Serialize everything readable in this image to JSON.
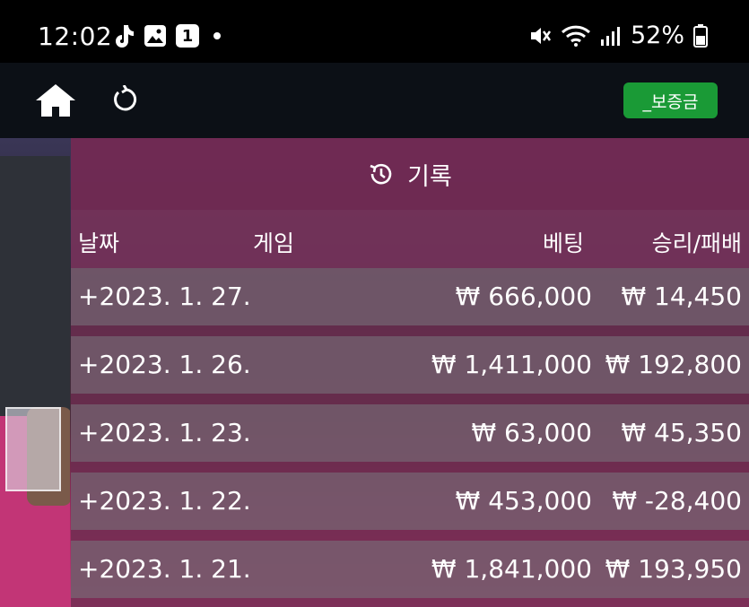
{
  "status_bar": {
    "time": "12:02",
    "notification_badge": "1",
    "battery": "52%"
  },
  "app_bar": {
    "deposit_label": "_보증금"
  },
  "panel": {
    "title": "기록",
    "columns": {
      "date": "날짜",
      "game": "게임",
      "bet": "베팅",
      "win_loss": "승리/패배"
    },
    "rows": [
      {
        "date": "+2023. 1. 27.",
        "bet": "₩ 666,000",
        "win_loss": "₩ 14,450"
      },
      {
        "date": "+2023. 1. 26.",
        "bet": "₩ 1,411,000",
        "win_loss": "₩ 192,800"
      },
      {
        "date": "+2023. 1. 23.",
        "bet": "₩ 63,000",
        "win_loss": "₩ 45,350"
      },
      {
        "date": "+2023. 1. 22.",
        "bet": "₩ 453,000",
        "win_loss": "₩ -28,400"
      },
      {
        "date": "+2023. 1. 21.",
        "bet": "₩ 1,841,000",
        "win_loss": "₩ 193,950"
      }
    ]
  },
  "icons": {
    "status_left": [
      "tiktok-icon",
      "gallery-icon",
      "badge-one-icon",
      "dot-icon"
    ],
    "status_right": [
      "mute-icon",
      "wifi-icon",
      "signal-icon",
      "battery-icon"
    ],
    "app_bar": [
      "home-icon",
      "refresh-icon"
    ],
    "panel": [
      "history-icon"
    ]
  },
  "colors": {
    "deposit_button": "#1a9a36",
    "panel_bg": "#6e2d50",
    "row_bg": "#78787d"
  }
}
